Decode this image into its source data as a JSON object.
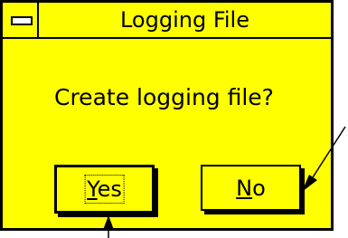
{
  "window": {
    "title": "Logging File",
    "system_menu_icon": "minus-bar-icon"
  },
  "dialog": {
    "message": "Create logging file?"
  },
  "buttons": {
    "yes": {
      "mnemonic": "Y",
      "rest": "es",
      "focused": true
    },
    "no": {
      "mnemonic": "N",
      "rest": "o",
      "focused": false
    }
  },
  "colors": {
    "background": "#ffff00",
    "border": "#000000"
  },
  "annotations": {
    "arrow_icons": [
      "callout-arrow-to-yes-icon",
      "callout-arrow-to-no-icon"
    ]
  }
}
